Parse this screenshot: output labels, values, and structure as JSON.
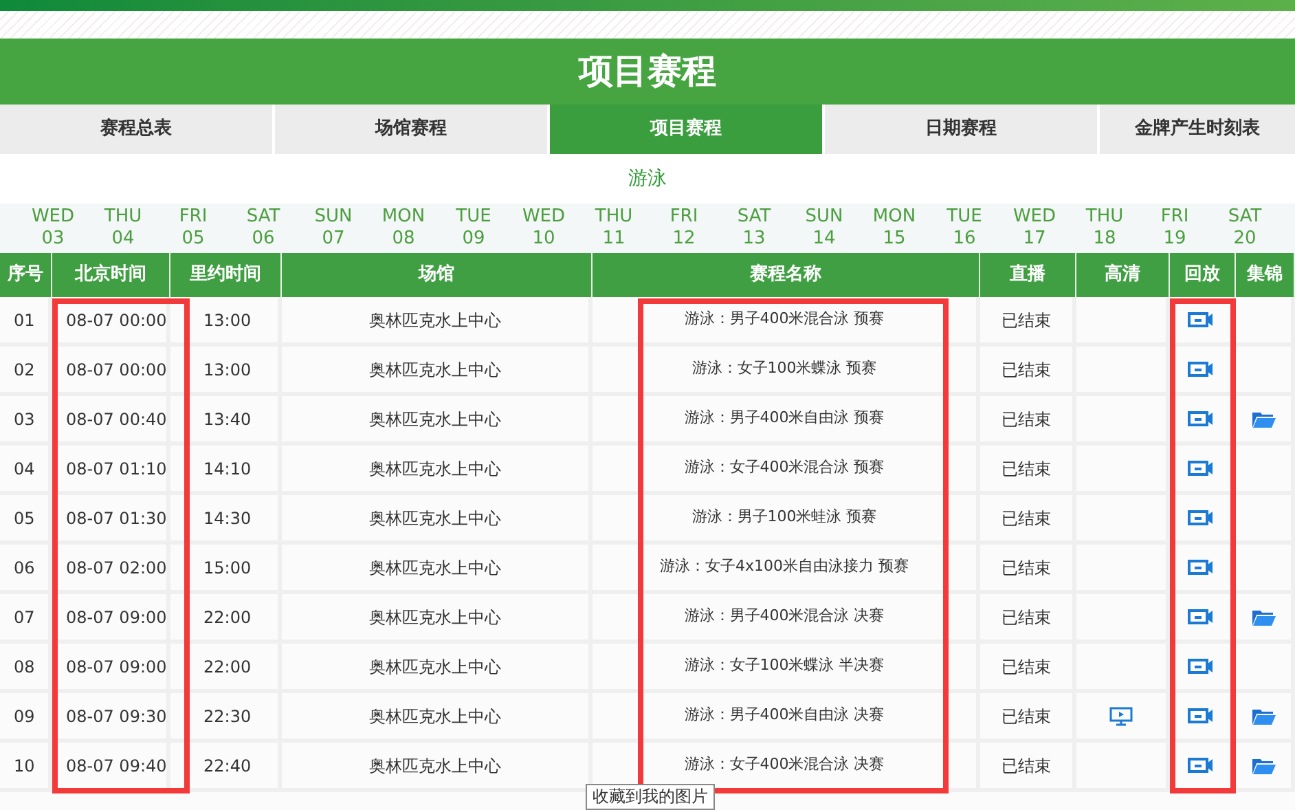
{
  "page_title": "项目赛程",
  "tabs": [
    {
      "label": "赛程总表",
      "selected": false
    },
    {
      "label": "场馆赛程",
      "selected": false
    },
    {
      "label": "项目赛程",
      "selected": true
    },
    {
      "label": "日期赛程",
      "selected": false
    },
    {
      "label": "金牌产生时刻表",
      "selected": false
    }
  ],
  "sport": "游泳",
  "dates": [
    {
      "day": "WED",
      "date": "03"
    },
    {
      "day": "THU",
      "date": "04"
    },
    {
      "day": "FRI",
      "date": "05"
    },
    {
      "day": "SAT",
      "date": "06"
    },
    {
      "day": "SUN",
      "date": "07"
    },
    {
      "day": "MON",
      "date": "08"
    },
    {
      "day": "TUE",
      "date": "09"
    },
    {
      "day": "WED",
      "date": "10"
    },
    {
      "day": "THU",
      "date": "11"
    },
    {
      "day": "FRI",
      "date": "12"
    },
    {
      "day": "SAT",
      "date": "13"
    },
    {
      "day": "SUN",
      "date": "14"
    },
    {
      "day": "MON",
      "date": "15"
    },
    {
      "day": "TUE",
      "date": "16"
    },
    {
      "day": "WED",
      "date": "17"
    },
    {
      "day": "THU",
      "date": "18"
    },
    {
      "day": "FRI",
      "date": "19"
    },
    {
      "day": "SAT",
      "date": "20"
    }
  ],
  "table": {
    "columns": [
      {
        "label": "序号",
        "highlighted": false
      },
      {
        "label": "北京时间",
        "highlighted": true
      },
      {
        "label": "里约时间",
        "highlighted": false
      },
      {
        "label": "场馆",
        "highlighted": false
      },
      {
        "label": "赛程名称",
        "highlighted": true
      },
      {
        "label": "直播",
        "highlighted": false
      },
      {
        "label": "高清",
        "highlighted": false
      },
      {
        "label": "回放",
        "highlighted": true
      },
      {
        "label": "集锦",
        "highlighted": false
      }
    ],
    "rows": [
      {
        "no": "01",
        "beijing": "08-07 00:00",
        "rio": "13:00",
        "venue": "奥林匹克水上中心",
        "event": "游泳：男子400米混合泳 预赛",
        "live": "已结束",
        "hd": false,
        "replay": true,
        "clips": false
      },
      {
        "no": "02",
        "beijing": "08-07 00:00",
        "rio": "13:00",
        "venue": "奥林匹克水上中心",
        "event": "游泳：女子100米蝶泳 预赛",
        "live": "已结束",
        "hd": false,
        "replay": true,
        "clips": false
      },
      {
        "no": "03",
        "beijing": "08-07 00:40",
        "rio": "13:40",
        "venue": "奥林匹克水上中心",
        "event": "游泳：男子400米自由泳 预赛",
        "live": "已结束",
        "hd": false,
        "replay": true,
        "clips": true
      },
      {
        "no": "04",
        "beijing": "08-07 01:10",
        "rio": "14:10",
        "venue": "奥林匹克水上中心",
        "event": "游泳：女子400米混合泳 预赛",
        "live": "已结束",
        "hd": false,
        "replay": true,
        "clips": false
      },
      {
        "no": "05",
        "beijing": "08-07 01:30",
        "rio": "14:30",
        "venue": "奥林匹克水上中心",
        "event": "游泳：男子100米蛙泳 预赛",
        "live": "已结束",
        "hd": false,
        "replay": true,
        "clips": false
      },
      {
        "no": "06",
        "beijing": "08-07 02:00",
        "rio": "15:00",
        "venue": "奥林匹克水上中心",
        "event": "游泳：女子4x100米自由泳接力 预赛",
        "live": "已结束",
        "hd": false,
        "replay": true,
        "clips": false
      },
      {
        "no": "07",
        "beijing": "08-07 09:00",
        "rio": "22:00",
        "venue": "奥林匹克水上中心",
        "event": "游泳：男子400米混合泳 决赛",
        "live": "已结束",
        "hd": false,
        "replay": true,
        "clips": true
      },
      {
        "no": "08",
        "beijing": "08-07 09:00",
        "rio": "22:00",
        "venue": "奥林匹克水上中心",
        "event": "游泳：女子100米蝶泳 半决赛",
        "live": "已结束",
        "hd": false,
        "replay": true,
        "clips": false
      },
      {
        "no": "09",
        "beijing": "08-07 09:30",
        "rio": "22:30",
        "venue": "奥林匹克水上中心",
        "event": "游泳：男子400米自由泳 决赛",
        "live": "已结束",
        "hd": true,
        "replay": true,
        "clips": true
      },
      {
        "no": "10",
        "beijing": "08-07 09:40",
        "rio": "22:40",
        "venue": "奥林匹克水上中心",
        "event": "游泳：女子400米混合泳 决赛",
        "live": "已结束",
        "hd": false,
        "replay": true,
        "clips": true
      }
    ]
  },
  "tooltip": "收藏到我的图片"
}
